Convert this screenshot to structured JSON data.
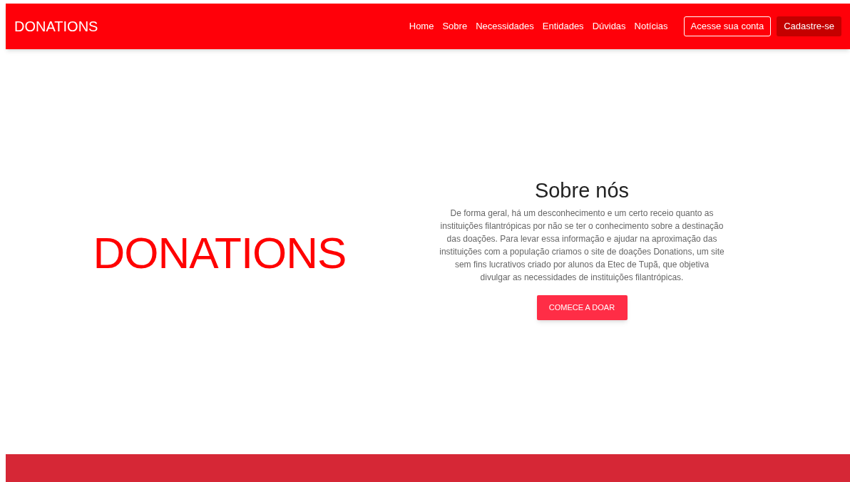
{
  "header": {
    "logo": "DONATIONS",
    "nav": [
      "Home",
      "Sobre",
      "Necessidades",
      "Entidades",
      "Dúvidas",
      "Notícias"
    ],
    "login_button": "Acesse sua conta",
    "signup_button": "Cadastre-se"
  },
  "hero": {
    "logo": "DONATIONS",
    "title": "Sobre nós",
    "text": "De forma geral, há um desconhecimento e um certo receio quanto as instituições filantrópicas por não se ter o conhecimento sobre a destinação das doações. Para levar essa informação e ajudar na aproximação das instituições com a população criamos o site de doações Donations, um site sem fins lucrativos criado por alunos da Etec de Tupã, que objetiva divulgar as necessidades de instituições filantrópicas.",
    "button": "COMECE A DOAR"
  }
}
